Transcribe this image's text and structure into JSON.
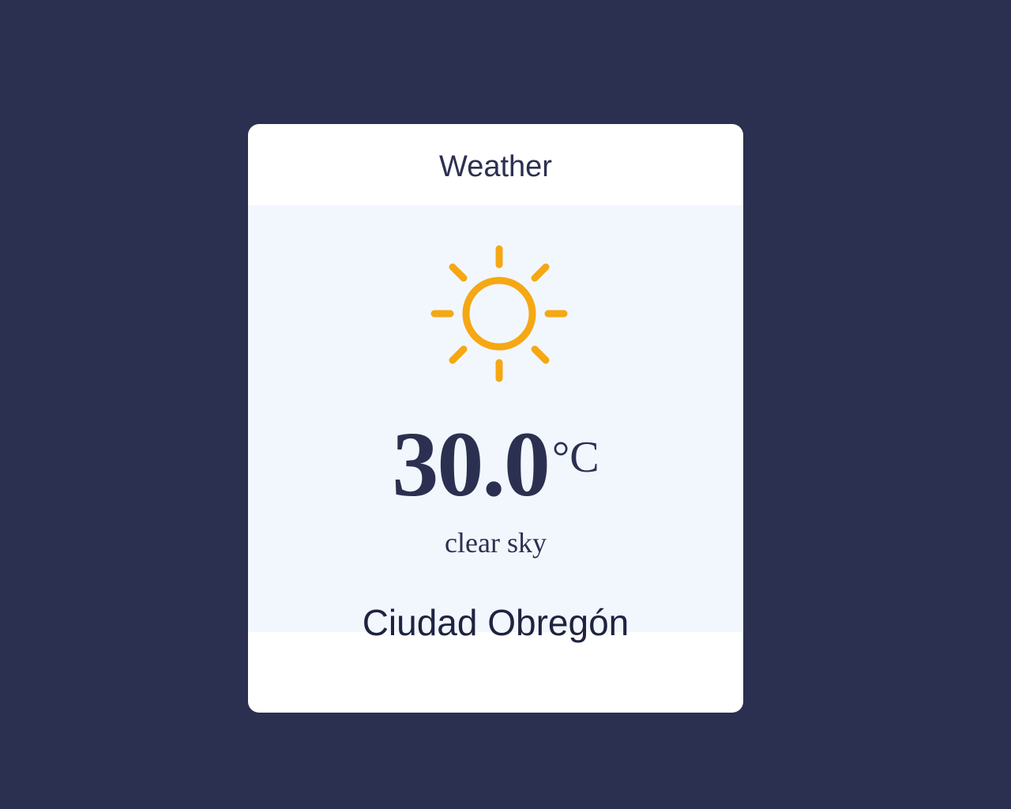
{
  "card": {
    "header": "Weather",
    "icon": "sun-icon",
    "temperature": "30.0",
    "unit": "°C",
    "description": "clear sky",
    "city": "Ciudad Obregón"
  },
  "colors": {
    "background": "#2c3050",
    "card": "#ffffff",
    "panel": "#f2f7fe",
    "sun": "#f5a814",
    "text": "#2c3050"
  }
}
